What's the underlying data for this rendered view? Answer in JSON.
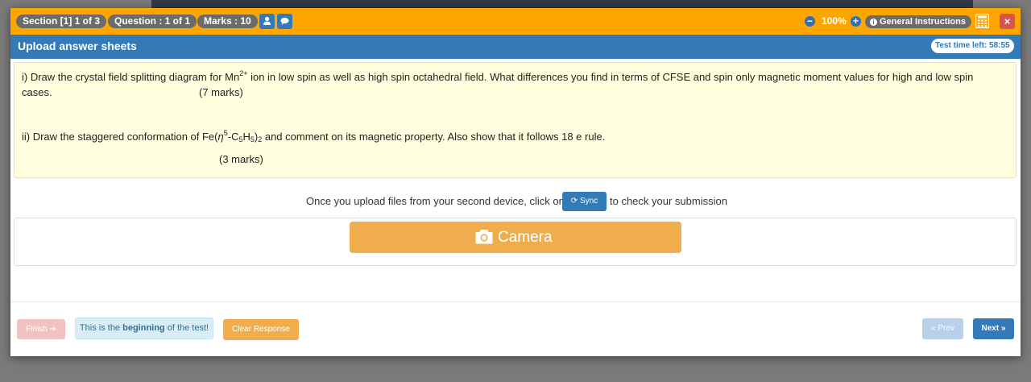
{
  "topbar": {
    "section": "Section [1] 1 of 3",
    "question": "Question : 1 of 1",
    "marks": "Marks : 10",
    "zoom": "100%",
    "zoom_out": "−",
    "zoom_in": "+",
    "general_instructions": "General Instructions",
    "close": "×",
    "icons": [
      "user-icon",
      "comments-icon",
      "info-icon",
      "calculator-icon",
      "close-icon"
    ],
    "accent_color": "#ffa500"
  },
  "header": {
    "title": "Upload answer sheets",
    "timer": "Test time left: 58:55",
    "color": "#337ab7"
  },
  "question": {
    "q1_prefix": "i) Draw the crystal field splitting diagram for Mn",
    "q1_sup": "2+",
    "q1_suffix": " ion in low spin as well as high spin octahedral field. What differences you find in terms of CFSE and spin only magnetic moment values for high and low spin",
    "q1_line2": "cases.",
    "q1_marks": "(7 marks)",
    "q2_a": "ii) Draw the staggered conformation of Fe(",
    "q2_eta": "η",
    "q2_sup": "5",
    "q2_b": "-C",
    "q2_sub1": "5",
    "q2_c": "H",
    "q2_sub2": "5",
    "q2_d": ")",
    "q2_sub3": "2",
    "q2_e": " and comment on its magnetic property. Also show that it follows 18 e rule.",
    "q2_marks": "(3 marks)"
  },
  "sync": {
    "pre": "Once you upload files from your second device, click on",
    "button": "⟳ Sync",
    "post": "to check your submission"
  },
  "camera": {
    "label": "Camera",
    "icon": "camera-icon",
    "color": "#f0ad4e"
  },
  "footer": {
    "finish": "Finish ➔",
    "note_pre": "This is the ",
    "note_bold": "beginning",
    "note_post": " of the test!",
    "clear": "Clear Response",
    "prev": "« Prev",
    "next": "Next »"
  }
}
